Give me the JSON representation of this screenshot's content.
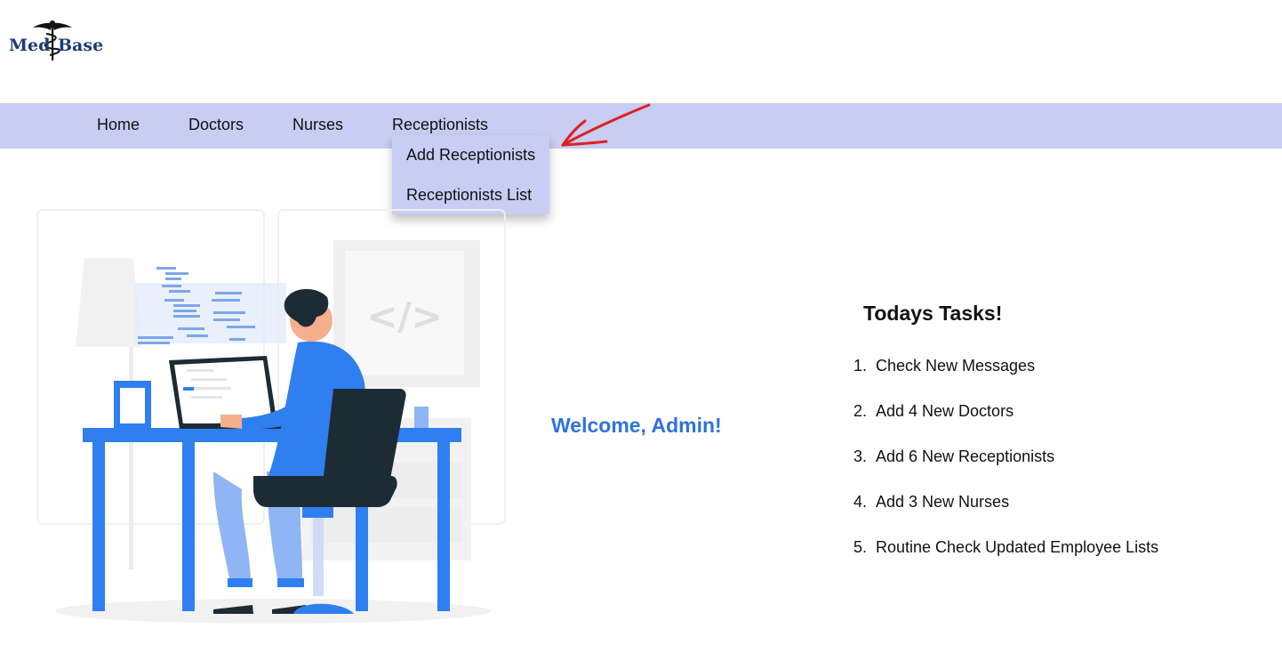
{
  "logo": {
    "part1": "Med",
    "part2": "Base",
    "icon": "caduceus-icon"
  },
  "nav": {
    "items": [
      {
        "label": "Home"
      },
      {
        "label": "Doctors"
      },
      {
        "label": "Nurses"
      },
      {
        "label": "Receptionists"
      }
    ],
    "dropdown": [
      {
        "label": "Add Receptionists"
      },
      {
        "label": "Receptionists List"
      }
    ]
  },
  "main": {
    "welcome": "Welcome, Admin!",
    "tasks_title": "Todays Tasks!",
    "tasks": [
      {
        "num": "1.",
        "text": "Check New Messages"
      },
      {
        "num": "2.",
        "text": "Add 4 New Doctors"
      },
      {
        "num": "3.",
        "text": "Add 6 New Receptionists"
      },
      {
        "num": "4.",
        "text": "Add 3 New Nurses"
      },
      {
        "num": "5.",
        "text": "Routine Check Updated Employee Lists"
      }
    ]
  },
  "illustration": {
    "code_symbol": "</>"
  },
  "colors": {
    "nav_bg": "#c7cdf3",
    "welcome": "#2f72e0",
    "accent_blue": "#2f7ff0",
    "arrow": "#e02020"
  }
}
